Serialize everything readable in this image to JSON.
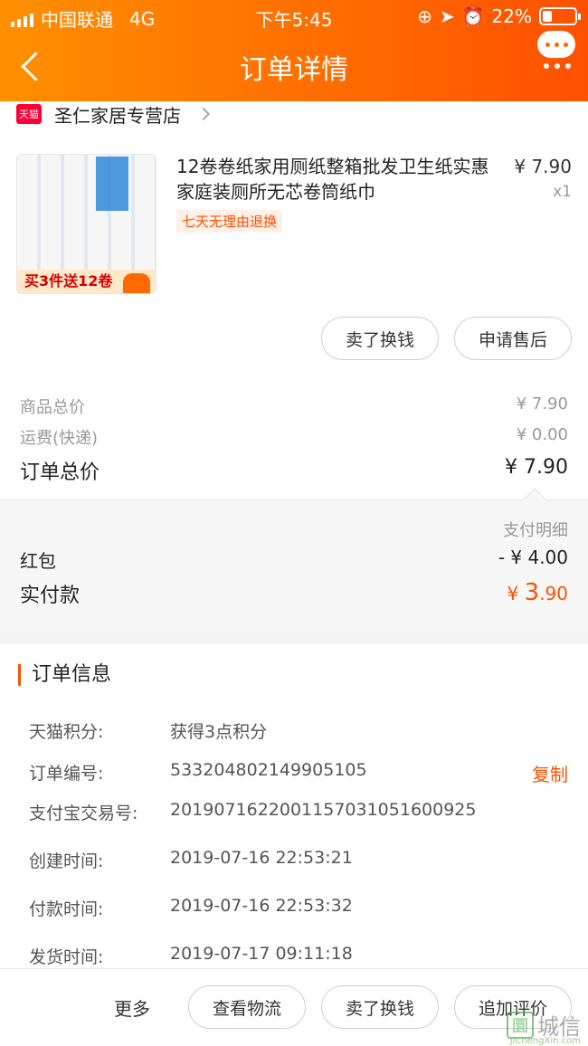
{
  "status_bar": {
    "carrier": "中国联通",
    "network": "4G",
    "time": "下午5:45",
    "battery": "22%"
  },
  "header": {
    "title": "订单详情"
  },
  "shop": {
    "logo_text": "天猫",
    "name": "圣仁家居专营店"
  },
  "product": {
    "title": "12卷卷纸家用厕纸整箱批发卫生纸实惠家庭装厕所无芯卷筒纸巾",
    "price": "¥ 7.90",
    "qty": "x1",
    "return_tag": "七天无理由退换",
    "thumb_banner": "买3件送12卷"
  },
  "product_actions": {
    "sell": "卖了换钱",
    "after_sale": "申请售后"
  },
  "price_summary": {
    "goods_label": "商品总价",
    "goods_value": "¥ 7.90",
    "shipping_label": "运费(快递)",
    "shipping_value": "¥ 0.00",
    "total_label": "订单总价",
    "total_value": "¥ 7.90"
  },
  "payment": {
    "detail_link": "支付明细",
    "redpacket_label": "红包",
    "redpacket_value": "- ¥ 4.00",
    "paid_label": "实付款",
    "paid_currency": "¥",
    "paid_int": "3",
    "paid_dec": ".90"
  },
  "order_info": {
    "title": "订单信息",
    "rows": [
      {
        "k": "天猫积分:",
        "v": "获得3点积分"
      },
      {
        "k": "订单编号:",
        "v": "533204802149905105"
      },
      {
        "k": "支付宝交易号:",
        "v": "2019071622001157031051600925"
      },
      {
        "k": "创建时间:",
        "v": "2019-07-16 22:53:21"
      },
      {
        "k": "付款时间:",
        "v": "2019-07-16 22:53:32"
      },
      {
        "k": "发货时间:",
        "v": "2019-07-17 09:11:18"
      }
    ],
    "copy": "复制"
  },
  "bottom_bar": {
    "more": "更多",
    "logistics": "查看物流",
    "sell": "卖了换钱",
    "review": "追加评价"
  },
  "watermark": {
    "glyph": "圜",
    "text": "城信",
    "url": "JiChengXin.com"
  },
  "colors": {
    "accent": "#ff5000",
    "header_start": "#ff9000"
  }
}
